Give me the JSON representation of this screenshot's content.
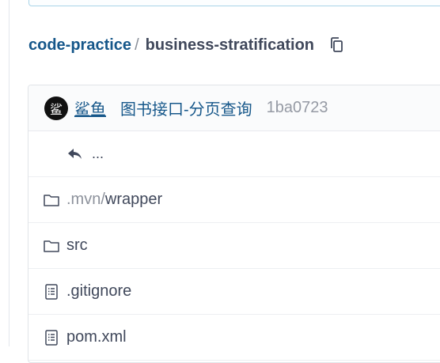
{
  "breadcrumb": {
    "owner": "code-practice",
    "separator": "/",
    "repo": "business-stratification",
    "copy_icon": "copy-icon"
  },
  "commit": {
    "avatar_text": "鲨",
    "author": "鲨鱼",
    "message": "图书接口-分页查询",
    "sha": "1ba0723"
  },
  "parent_dir": {
    "icon": "reply-arrow-icon",
    "label": "..."
  },
  "files": [
    {
      "type": "folder",
      "icon": "folder-icon",
      "prefix": ".mvn/",
      "name": "wrapper"
    },
    {
      "type": "folder",
      "icon": "folder-icon",
      "prefix": "",
      "name": "src"
    },
    {
      "type": "file",
      "icon": "file-text-icon",
      "prefix": "",
      "name": ".gitignore"
    },
    {
      "type": "file",
      "icon": "file-text-icon",
      "prefix": "",
      "name": "pom.xml"
    }
  ],
  "colors": {
    "link": "#16578a",
    "text": "#40485b",
    "muted": "#959aa4",
    "accent_border": "#a9d4e8"
  }
}
